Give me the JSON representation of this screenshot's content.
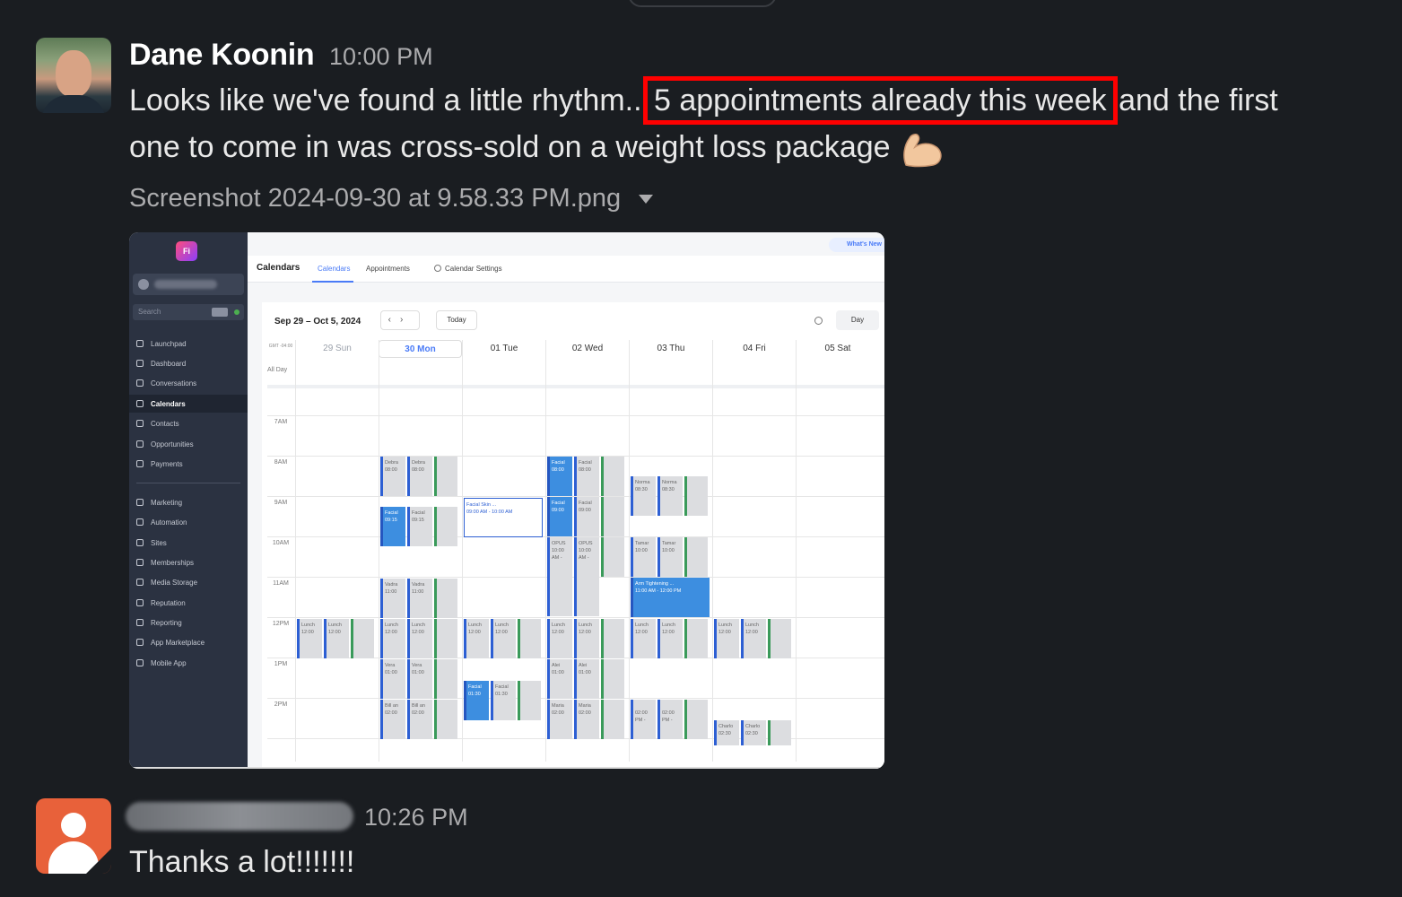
{
  "messages": [
    {
      "author": "Dane Koonin",
      "time": "10:00 PM",
      "text_before": "Looks like we've found a little rhythm..",
      "text_highlight": "5 appointments already this week",
      "text_after": "and the first",
      "text_line2": "one to come in was cross-sold on a weight loss package",
      "emoji": "flexed-biceps-icon",
      "attachment": {
        "filename": "Screenshot 2024-09-30 at 9.58.33 PM.png"
      }
    },
    {
      "author": "",
      "time": "10:26 PM",
      "text": "Thanks a lot!!!!!!!"
    }
  ],
  "colors": {
    "highlight_box": "#ff0000",
    "background": "#1a1d21",
    "default_avatar": "#e8613a"
  },
  "screenshot": {
    "logo_text": "Fi",
    "whats_new": "What's New",
    "search_placeholder": "Search",
    "nav": [
      "Launchpad",
      "Dashboard",
      "Conversations",
      "Calendars",
      "Contacts",
      "Opportunities",
      "Payments",
      "Marketing",
      "Automation",
      "Sites",
      "Memberships",
      "Media Storage",
      "Reputation",
      "Reporting",
      "App Marketplace",
      "Mobile App"
    ],
    "tabs": {
      "title": "Calendars",
      "calendars": "Calendars",
      "appointments": "Appointments",
      "settings": "Calendar Settings"
    },
    "date_range": "Sep 29 – Oct 5, 2024",
    "today_button": "Today",
    "view_button": "Day",
    "gmt": "GMT -04:00",
    "all_day": "All Day",
    "days": [
      "29 Sun",
      "30 Mon",
      "01 Tue",
      "02 Wed",
      "03 Thu",
      "04 Fri",
      "05 Sat"
    ],
    "hours": [
      "7AM",
      "8AM",
      "9AM",
      "10AM",
      "11AM",
      "12PM",
      "1PM",
      "2PM"
    ],
    "events": {
      "mon_8": [
        "Debra",
        "Debra"
      ],
      "mon_8_time": "08:00",
      "mon_9": [
        "Facial",
        "Facial"
      ],
      "mon_9_time": "09:15",
      "mon_11": [
        "Vadra",
        "Vadra"
      ],
      "mon_11_time": "11:00",
      "mon_1": [
        "Vera",
        "Vera"
      ],
      "mon_1_time": "01:00",
      "mon_2": [
        "Bill an",
        "Bill an"
      ],
      "mon_2_time": "02:00",
      "tue_9_title": "Facial Skin ...",
      "tue_9_time": "09:00 AM - 10:00 AM",
      "tue_1": [
        "Facial",
        "Facial"
      ],
      "tue_1_time": "01:30",
      "wed_8": [
        "Facial",
        "Facial"
      ],
      "wed_8_time": "08:00",
      "wed_9": [
        "Facial",
        "Facial"
      ],
      "wed_9_time": "09:00",
      "wed_10": [
        "OPUS",
        "OPUS"
      ],
      "wed_10_time": "10:00 AM -",
      "wed_1": [
        "Alei",
        "Alei"
      ],
      "wed_1_time": "01:00",
      "wed_2": [
        "Maria",
        "Maria"
      ],
      "wed_2_time": "02:00",
      "thu_8": [
        "Norma",
        "Norma"
      ],
      "thu_8_time": "08:30",
      "thu_10": [
        "Tamar",
        "Tamar"
      ],
      "thu_10_time": "10:00",
      "thu_11_title": "Arm Tightening ...",
      "thu_11_time": "11:00 AM - 12:00 PM",
      "thu_2_time": "02:00 PM -",
      "fri_2": [
        "Charlo",
        "Charlo"
      ],
      "fri_2_time": "02:30",
      "lunch": "Lunch",
      "lunch_time": "12:00"
    }
  }
}
